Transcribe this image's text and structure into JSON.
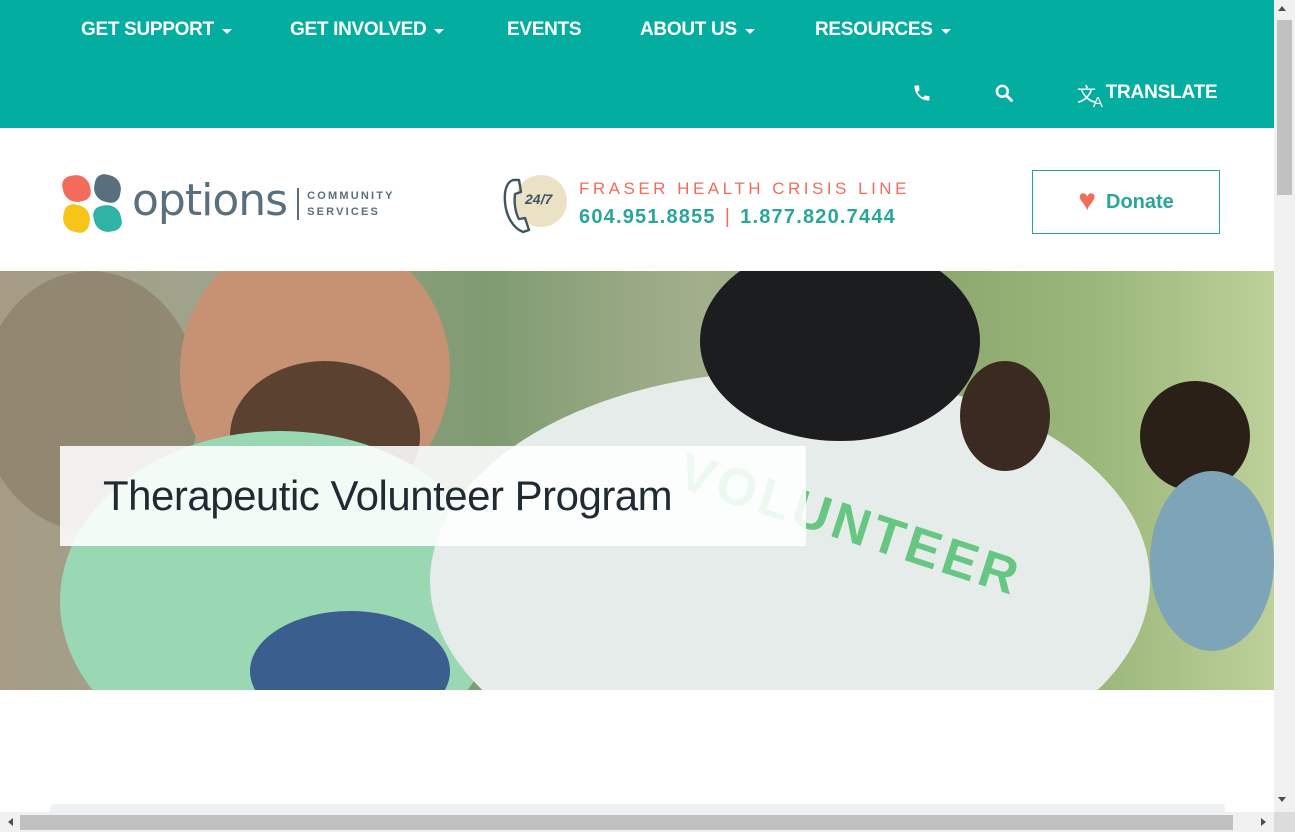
{
  "nav": {
    "items": [
      {
        "label": "GET SUPPORT",
        "has_dropdown": true
      },
      {
        "label": "GET INVOLVED",
        "has_dropdown": true
      },
      {
        "label": "EVENTS",
        "has_dropdown": false
      },
      {
        "label": "ABOUT US",
        "has_dropdown": true
      },
      {
        "label": "RESOURCES",
        "has_dropdown": true
      }
    ],
    "utility": {
      "phone_icon": "phone-icon",
      "search_icon": "search-icon",
      "translate_label": "TRANSLATE",
      "translate_icon": "translate-icon"
    }
  },
  "header": {
    "logo": {
      "wordmark": "options",
      "sub_line1": "COMMUNITY",
      "sub_line2": "SERVICES"
    },
    "crisis": {
      "badge": "24/7",
      "title": "FRASER HEALTH CRISIS LINE",
      "phone1": "604.951.8855",
      "separator": "|",
      "phone2": "1.877.820.7444"
    },
    "donate_label": "Donate"
  },
  "hero": {
    "title": "Therapeutic Volunteer Program",
    "shirt_text": "VOLUNTEER"
  },
  "colors": {
    "teal": "#03ad9f",
    "accent_teal": "#2aa59a",
    "coral": "#f26b5b",
    "slate": "#5a6f7d"
  }
}
